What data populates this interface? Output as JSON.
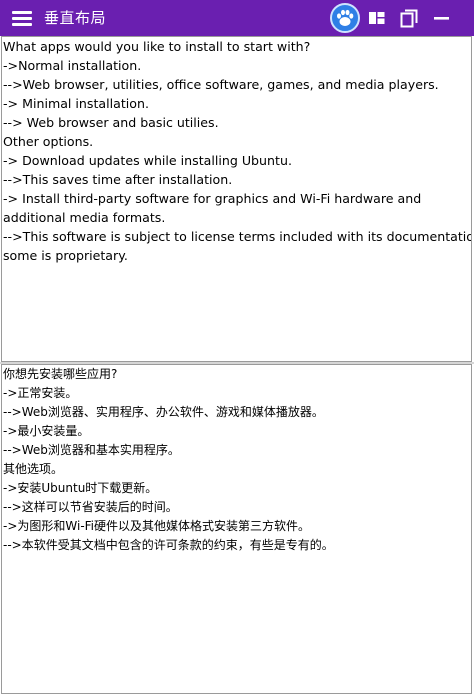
{
  "window": {
    "title": "垂直布局",
    "accent_color": "#6a1fb0"
  },
  "toolbar": {
    "menu_icon": "hamburger-menu-icon",
    "app_icon": "paw-app-icon",
    "layout_icon": "grid-layout-icon",
    "restore_icon": "restore-window-icon",
    "minimize_icon": "minimize-icon"
  },
  "top_pane": {
    "lines": [
      "What apps would you like to install to start with?",
      "->Normal installation.",
      "-->Web browser, utilities, office software, games, and media players.",
      "-> Minimal installation.",
      "--> Web browser and basic utilies.",
      "Other options.",
      "-> Download updates while installing Ubuntu.",
      "-->This saves time after installation.",
      "-> Install third-party software for graphics and Wi-Fi hardware and",
      "additional media formats.",
      "-->This software is subject to license terms included with its documentation,",
      "some is proprietary."
    ]
  },
  "bottom_pane": {
    "lines": [
      "你想先安装哪些应用?",
      "->正常安装。",
      "-->Web浏览器、实用程序、办公软件、游戏和媒体播放器。",
      "->最小安装量。",
      "-->Web浏览器和基本实用程序。",
      "其他选项。",
      "->安装Ubuntu时下载更新。",
      "-->这样可以节省安装后的时间。",
      "->为图形和Wi-Fi硬件以及其他媒体格式安装第三方软件。",
      "-->本软件受其文档中包含的许可条款的约束，有些是专有的。"
    ]
  }
}
